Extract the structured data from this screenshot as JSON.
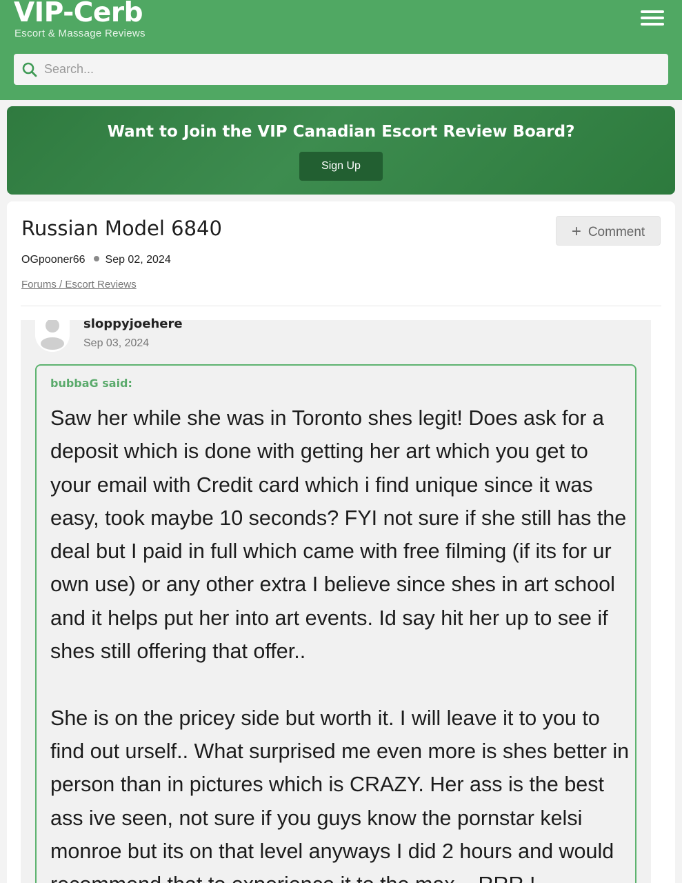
{
  "header": {
    "logo": "VIP-Cerb",
    "tagline": "Escort & Massage Reviews",
    "menu_icon": "hamburger-menu-icon",
    "search_placeholder": "Search..."
  },
  "banner": {
    "title": "Want to Join the VIP Canadian Escort Review Board?",
    "signup_label": "Sign Up"
  },
  "post": {
    "title": "Russian Model 6840",
    "comment_label": "Comment",
    "author": "OGpooner66",
    "date": "Sep 02, 2024",
    "breadcrumb": "Forums / Escort Reviews"
  },
  "reply": {
    "username": "sloppyjoehere",
    "date": "Sep 03, 2024",
    "quote_author": "bubbaG said:",
    "paragraphs": [
      "Saw her while she was in Toronto shes legit! Does ask for a deposit which is done with getting her art which you get to your email with Credit card which i find unique since it was easy, took maybe 10 seconds? FYI not sure if she still has the deal but I paid in full which came with free filming (if its for ur own use) or any other extra I believe since shes in art school and it helps put her into art events. Id say hit her up to see if shes still offering that offer..",
      "She is on the pricey side but worth it. I will leave it to you to find out urself.. What surprised me even more is shes better in person than in pictures which is CRAZY. Her ass is the best ass ive seen, not sure if you guys know the pornstar kelsi monroe but its on that level anyways I did 2 hours and would recommend that to experience it to the max... RRR !"
    ]
  },
  "colors": {
    "header": "#50a863",
    "banner": "#3d8c4f",
    "signup_button": "#225f31",
    "quote_border": "#5db36f",
    "quote_author": "#5aaa6b"
  }
}
